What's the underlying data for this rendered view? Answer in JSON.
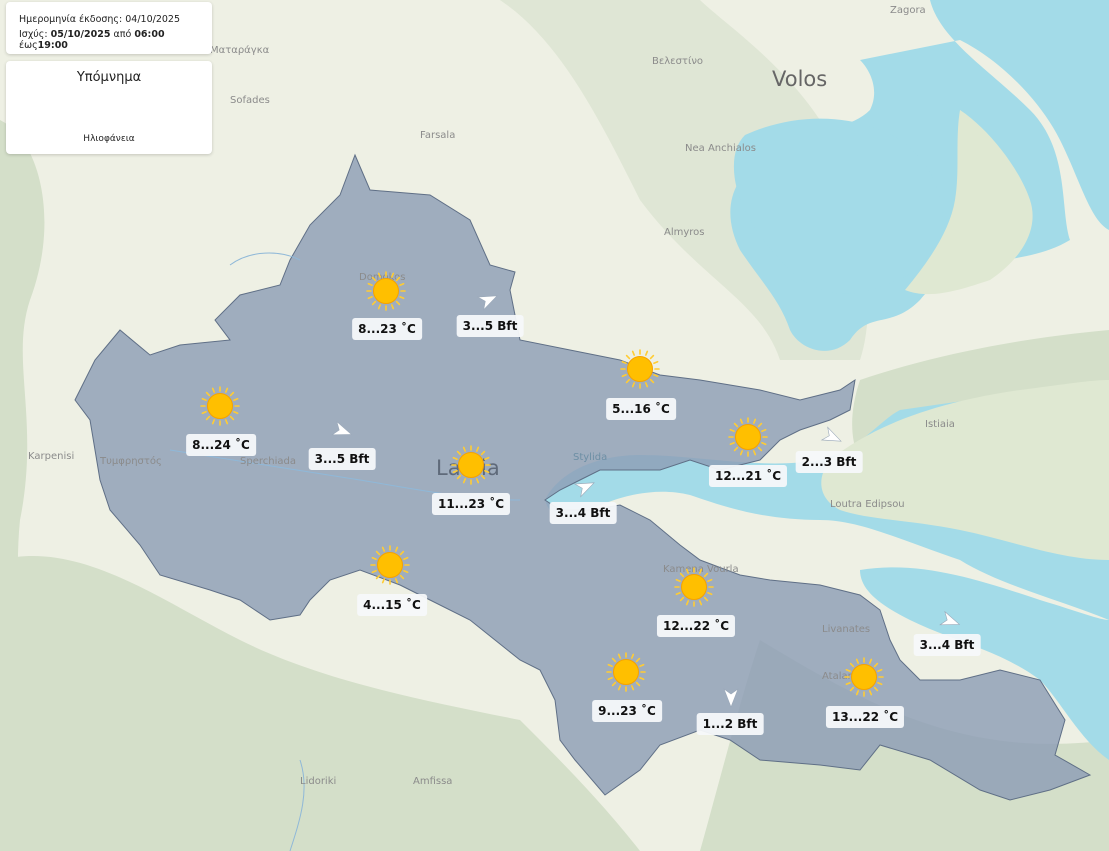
{
  "issue": {
    "issue_label": "Ημερομηνία έκδοσης:",
    "issue_date": "04/10/2025",
    "valid_label": "Ισχύς:",
    "valid_date": "05/10/2025",
    "from_word": "από",
    "from_time": "06:00",
    "to_word": "έως",
    "to_time": "19:00"
  },
  "legend": {
    "title": "Υπόμνημα",
    "items": [
      {
        "icon": "sun-icon",
        "label": "Ηλιοφάνεια"
      }
    ]
  },
  "colors": {
    "region_fill": "#8e9eb6",
    "sea": "#a3dbe8",
    "land": "#eef0e4",
    "sun": "#ffbf00",
    "sun_ray": "#ffcc33"
  },
  "places": {
    "zagora": "Zagora",
    "velestino": "Βελεστίνο",
    "volos": "Volos",
    "mataragka": "Ματαράγκα",
    "sofades": "Sofades",
    "farsala": "Farsala",
    "nea_anchialos": "Nea Anchialos",
    "almyros": "Almyros",
    "domokos": "Domokos",
    "istiaia": "Istiaia",
    "karpenisi": "Karpenisi",
    "tymfristos": "Τυμφρηστός",
    "sperchiada": "Sperchiada",
    "lamia": "Lamia",
    "stylida": "Stylida",
    "loutra_edipsou": "Loutra Edipsou",
    "kamena_vourla": "Kamena Vourla",
    "livanates": "Livanates",
    "atalanti": "Atalanti",
    "lidoriki": "Lidoriki",
    "amfissa": "Amfissa"
  },
  "forecast": {
    "temps": [
      {
        "icon": "sun-icon",
        "text": "8...23 ˚C"
      },
      {
        "icon": "sun-icon",
        "text": "8...24 ˚C"
      },
      {
        "icon": "sun-icon",
        "text": "5...16 ˚C"
      },
      {
        "icon": "sun-icon",
        "text": "12...21 ˚C"
      },
      {
        "icon": "sun-icon",
        "text": "11...23 ˚C"
      },
      {
        "icon": "sun-icon",
        "text": "4...15 ˚C"
      },
      {
        "icon": "sun-icon",
        "text": "12...22 ˚C"
      },
      {
        "icon": "sun-icon",
        "text": "9...23 ˚C"
      },
      {
        "icon": "sun-icon",
        "text": "13...22 ˚C"
      }
    ],
    "winds": [
      {
        "icon": "wind-arrow-icon",
        "text": "3...5 Bft"
      },
      {
        "icon": "wind-arrow-icon",
        "text": "3...5 Bft"
      },
      {
        "icon": "wind-arrow-icon",
        "text": "2...3 Bft"
      },
      {
        "icon": "wind-arrow-icon",
        "text": "3...4 Bft"
      },
      {
        "icon": "wind-arrow-icon",
        "text": "3...4 Bft"
      },
      {
        "icon": "wind-arrow-icon",
        "text": "1...2 Bft"
      }
    ]
  }
}
